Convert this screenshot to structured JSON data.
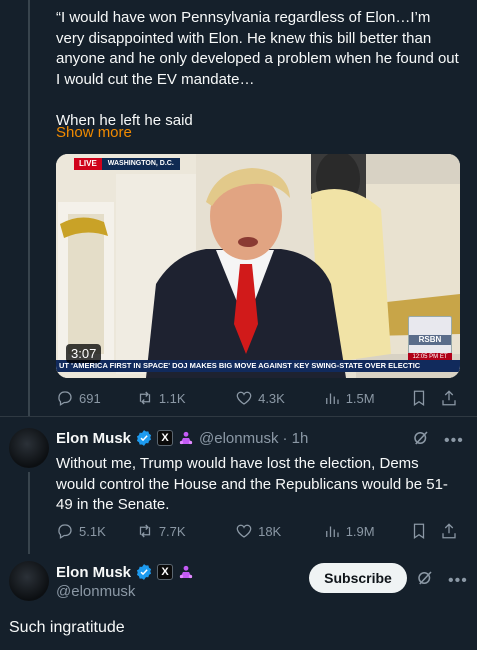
{
  "quoted_tweet": {
    "text": "“I would have won Pennsylvania regardless of Elon…I’m very disappointed with Elon. He knew this bill better than anyone and he only developed a problem when he found out I would cut the EV mandate…\n\nWhen he left he said",
    "show_more": "Show more",
    "video": {
      "live_label": "LIVE",
      "location": "WASHINGTON, D.C.",
      "duration": "3:07",
      "network": "RSBN",
      "network_time": "12:05 PM ET",
      "ticker": "UT 'AMERICA FIRST IN SPACE'    DOJ MAKES BIG MOVE AGAINST KEY SWING-STATE OVER ELECTIC"
    },
    "stats": {
      "replies": "691",
      "reposts": "1.1K",
      "likes": "4.3K",
      "views": "1.5M"
    }
  },
  "reply_tweet": {
    "name": "Elon Musk",
    "handle": "@elonmusk",
    "time": "· 1h",
    "text": "Without me, Trump would have lost the election, Dems would control the House and the Republicans would be 51-49 in the Senate.",
    "stats": {
      "replies": "5.1K",
      "reposts": "7.7K",
      "likes": "18K",
      "views": "1.9M"
    }
  },
  "main_tweet": {
    "name": "Elon Musk",
    "handle": "@elonmusk",
    "subscribe_label": "Subscribe",
    "text": "Such ingratitude"
  },
  "badges": {
    "x_badge": "X"
  },
  "icons": [
    "reply-icon",
    "repost-icon",
    "like-icon",
    "views-icon",
    "bookmark-icon",
    "share-icon",
    "verified-icon",
    "grok-icon",
    "more-icon",
    "doge-icon"
  ],
  "colors": {
    "background": "#15202b",
    "accent": "#f18a00",
    "verified": "#1d9bf0",
    "muted": "#8b98a5",
    "doge": "#c35bf5"
  }
}
